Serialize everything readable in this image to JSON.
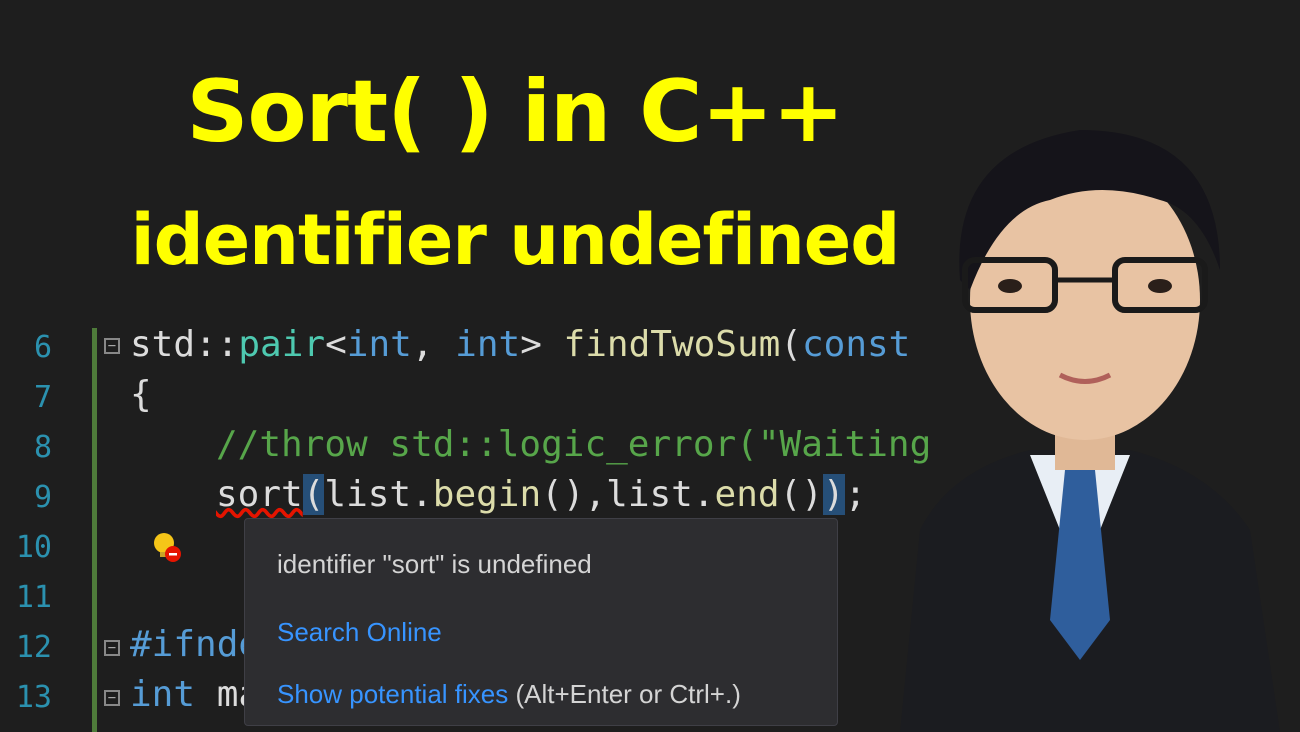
{
  "thumbnail": {
    "title_line1": "Sort( ) in C++",
    "title_line2": "identifier undefined",
    "title_color": "#ffff00",
    "background": "#1e1e1e"
  },
  "editor": {
    "lines": [
      {
        "number": "6"
      },
      {
        "number": "7"
      },
      {
        "number": "8"
      },
      {
        "number": "9"
      },
      {
        "number": "10"
      },
      {
        "number": "11"
      },
      {
        "number": "12"
      },
      {
        "number": "13"
      }
    ],
    "code": {
      "l6_a": "std::",
      "l6_b": "pair",
      "l6_c": "<",
      "l6_d": "int",
      "l6_e": ", ",
      "l6_f": "int",
      "l6_g": "> ",
      "l6_h": "findTwoSum",
      "l6_i": "(",
      "l6_j": "const",
      "l7": "{",
      "l8": "//throw std::logic_error(\"Waiting",
      "l9_a": "sort",
      "l9_b": "(",
      "l9_c": "list.",
      "l9_d": "begin",
      "l9_e": "(),list.",
      "l9_f": "end",
      "l9_g": "()",
      "l9_h": ")",
      "l9_i": ";",
      "l12": "#ifnde",
      "l13_a": "int",
      "l13_b": " ma"
    },
    "colors": {
      "keyword": "#569cd6",
      "type": "#4ec9b0",
      "function": "#dcdcaa",
      "comment": "#57a64a",
      "line_number": "#2b91af"
    }
  },
  "tooltip": {
    "message": "identifier \"sort\" is undefined",
    "search_link": "Search Online",
    "fixes_link": "Show potential fixes",
    "shortcut": "(Alt+Enter or Ctrl+.)"
  },
  "icons": {
    "lightbulb": "lightbulb-error-icon",
    "presenter": "presenter-photo"
  }
}
